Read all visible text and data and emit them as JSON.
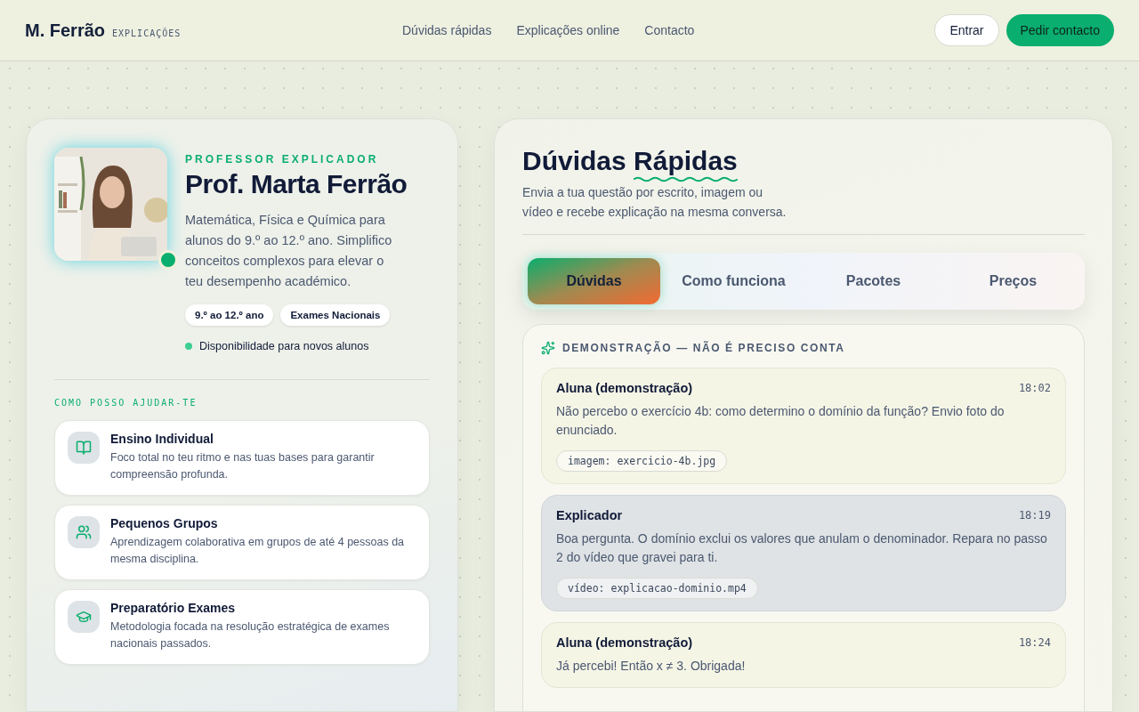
{
  "header": {
    "brand": "M. Ferrão",
    "brand_sub": "EXPLICAÇÕES",
    "nav": [
      {
        "label": "Dúvidas rápidas"
      },
      {
        "label": "Explicações online"
      },
      {
        "label": "Contacto"
      }
    ],
    "login": "Entrar",
    "cta": "Pedir contacto"
  },
  "profile": {
    "photo": {
      "kind": "picture"
    },
    "eyebrow": "PROFESSOR EXPLICADOR",
    "name": "Prof. Marta Ferrão",
    "bio": "Matemática, Física e Química para alunos do 9.º ao 12.º ano. Simplifico conceitos complexos para elevar o teu desempenho académico.",
    "tags": [
      "9.º ao 12.º ano",
      "Exames Nacionais"
    ],
    "availability": "Disponibilidade para novos alunos"
  },
  "services": {
    "heading": "COMO POSSO AJUDAR-TE",
    "items": [
      {
        "kind": "book",
        "title": "Ensino Individual",
        "description": "Foco total no teu ritmo e nas tuas bases para garantir compreensão profunda."
      },
      {
        "kind": "group",
        "title": "Pequenos Grupos",
        "description": "Aprendizagem colaborativa em grupos de até 4 pessoas da mesma disciplina."
      },
      {
        "kind": "exam",
        "title": "Preparatório Exames",
        "description": "Metodologia focada na resolução estratégica de exames nacionais passados."
      }
    ]
  },
  "main": {
    "title_parts": [
      {
        "text": "Dúvidas",
        "underlined": false
      },
      {
        "text": "Rápidas",
        "underlined": true
      }
    ],
    "subtitle": "Envia a tua questão por escrito, imagem ou vídeo e recebe explicação na mesma conversa.",
    "tabs": [
      {
        "label": "Dúvidas",
        "selected": true
      },
      {
        "label": "Como funciona",
        "selected": false
      },
      {
        "label": "Pacotes",
        "selected": false
      },
      {
        "label": "Preços",
        "selected": false
      }
    ],
    "demo": {
      "label": "DEMONSTRAÇÃO — NÃO É PRECISO CONTA",
      "messages": [
        {
          "kind": "student",
          "author": "Aluna (demonstração)",
          "time": "18:02",
          "text": "Não percebo o exercício 4b: como determino o domínio da função? Envio foto do enunciado.",
          "attachment": "imagem: exercicio-4b.jpg"
        },
        {
          "kind": "tutor",
          "author": "Explicador",
          "time": "18:19",
          "text": "Boa pergunta. O domínio exclui os valores que anulam o denominador. Repara no passo 2 do vídeo que gravei para ti.",
          "attachment": "vídeo: explicacao-dominio.mp4"
        },
        {
          "kind": "student",
          "author": "Aluna (demonstração)",
          "time": "18:24",
          "text": "Já percebi! Então x ≠ 3. Obrigada!"
        }
      ]
    }
  }
}
